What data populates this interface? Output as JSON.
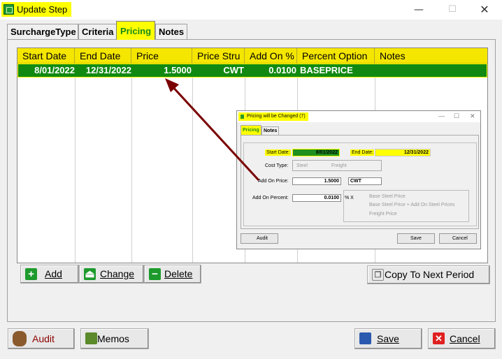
{
  "window": {
    "title": "Update Step",
    "minimize": "—",
    "maximize": "☐",
    "close": "✕"
  },
  "tabs": {
    "surcharge_type": "SurchargeType",
    "criteria": "Criteria",
    "pricing": "Pricing",
    "notes": "Notes"
  },
  "grid": {
    "columns": [
      "Start Date",
      "End Date",
      "Price",
      "Price Stru",
      "Add On %",
      "Percent Option",
      "Notes"
    ],
    "rows": [
      {
        "start_date": "8/01/2022",
        "end_date": "12/31/2022",
        "price": "1.5000",
        "price_structure": "CWT",
        "add_on_pct": "0.0100",
        "percent_option": "BASEPRICE",
        "notes": ""
      }
    ]
  },
  "buttons": {
    "add": "Add",
    "change": "Change",
    "delete": "Delete",
    "copy": "Copy To Next Period",
    "audit": "Audit",
    "memos": "Memos",
    "save": "Save",
    "cancel": "Cancel"
  },
  "mini_dialog": {
    "title": "Pricing will be Changed  (7)",
    "tab_pricing": "Pricing",
    "tab_notes": "Notes",
    "start_date_label": "Start Date:",
    "start_date": "8/01/2022",
    "end_date_label": "End Date:",
    "end_date": "12/31/2022",
    "cost_type_label": "Cost Type:",
    "cost_type_steel": "Steel",
    "cost_type_freight": "Freight",
    "add_on_price_label": "Add On Price:",
    "add_on_price": "1.5000",
    "unit": "CWT",
    "add_on_percent_label": "Add On Percent:",
    "add_on_percent": "0.0100",
    "pct_x": "% X",
    "opt1": "Base Steel Price",
    "opt2": "Base Steel Price + Add On Steel Prices",
    "opt3": "Freight Price",
    "audit": "Audit",
    "save": "Save",
    "cancel": "Cancel"
  },
  "colors": {
    "highlight": "#ffff00",
    "selected_row": "#128a12",
    "arrow": "#7a0000"
  }
}
